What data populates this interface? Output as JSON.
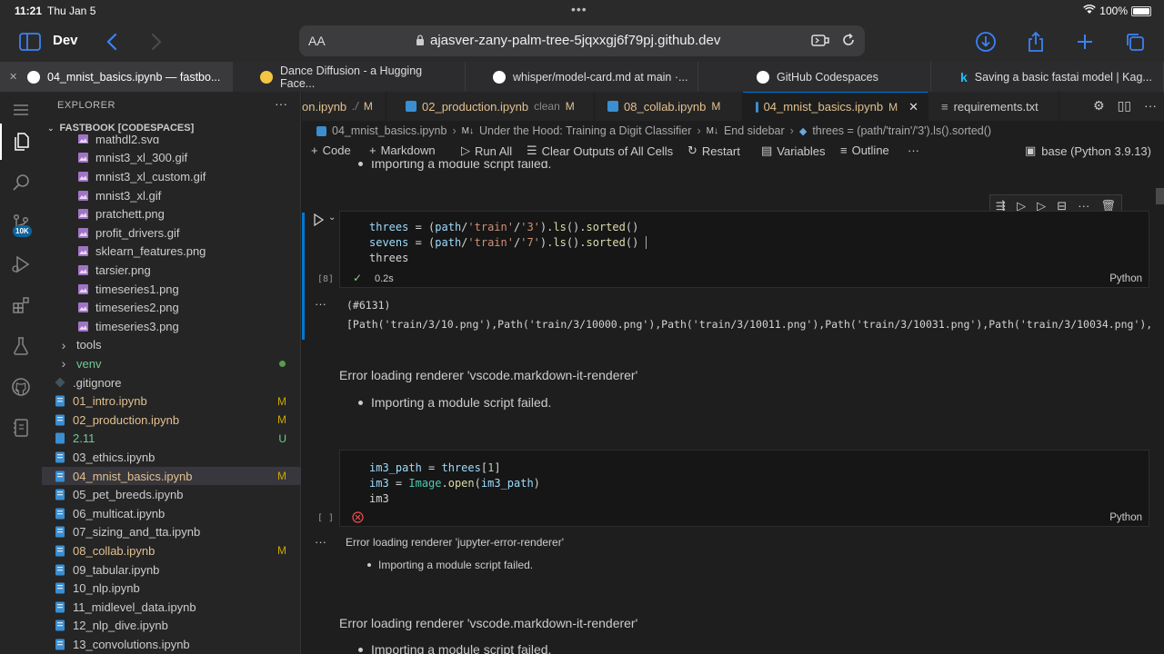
{
  "status": {
    "time": "11:21",
    "date": "Thu Jan 5",
    "battery": "100%"
  },
  "browser": {
    "sidebar_label": "Dev",
    "text_size": "AA",
    "url": "ajasver-zany-palm-tree-5jqxxgj6f79pj.github.dev",
    "tabs": [
      {
        "title": "04_mnist_basics.ipynb — fastbo...",
        "active": true
      },
      {
        "title": "Dance Diffusion - a Hugging Face..."
      },
      {
        "title": "whisper/model-card.md at main ·..."
      },
      {
        "title": "GitHub Codespaces"
      },
      {
        "title": "Saving a basic fastai model | Kag..."
      }
    ]
  },
  "explorer": {
    "title": "EXPLORER",
    "section": "FASTBOOK [CODESPACES]",
    "items": [
      {
        "name": "mathdl2.svg"
      },
      {
        "name": "mnist3_xl_300.gif"
      },
      {
        "name": "mnist3_xl_custom.gif"
      },
      {
        "name": "mnist3_xl.gif"
      },
      {
        "name": "pratchett.png"
      },
      {
        "name": "profit_drivers.gif"
      },
      {
        "name": "sklearn_features.png"
      },
      {
        "name": "tarsier.png"
      },
      {
        "name": "timeseries1.png"
      },
      {
        "name": "timeseries2.png"
      },
      {
        "name": "timeseries3.png"
      },
      {
        "name": "tools"
      },
      {
        "name": "venv"
      },
      {
        "name": ".gitignore"
      },
      {
        "name": "01_intro.ipynb",
        "status": "M"
      },
      {
        "name": "02_production.ipynb",
        "status": "M"
      },
      {
        "name": "2.11",
        "status": "U"
      },
      {
        "name": "03_ethics.ipynb"
      },
      {
        "name": "04_mnist_basics.ipynb",
        "status": "M"
      },
      {
        "name": "05_pet_breeds.ipynb"
      },
      {
        "name": "06_multicat.ipynb"
      },
      {
        "name": "07_sizing_and_tta.ipynb"
      },
      {
        "name": "08_collab.ipynb",
        "status": "M"
      },
      {
        "name": "09_tabular.ipynb"
      },
      {
        "name": "10_nlp.ipynb"
      },
      {
        "name": "11_midlevel_data.ipynb"
      },
      {
        "name": "12_nlp_dive.ipynb"
      },
      {
        "name": "13_convolutions.ipynb"
      }
    ]
  },
  "activity": {
    "badge": "10K"
  },
  "editor": {
    "tabs": [
      {
        "title": "on.ipynb",
        "extra": "./",
        "mark": "M"
      },
      {
        "title": "02_production.ipynb",
        "extra": "clean",
        "mark": "M"
      },
      {
        "title": "08_collab.ipynb",
        "mark": "M"
      },
      {
        "title": "04_mnist_basics.ipynb",
        "mark": "M",
        "active": true
      },
      {
        "title": "requirements.txt"
      }
    ],
    "breadcrumbs": [
      "04_mnist_basics.ipynb",
      "Under the Hood: Training a Digit Classifier",
      "End sidebar",
      "threes = (path/'train'/'3').ls().sorted()"
    ],
    "toolbar": {
      "code": "Code",
      "markdown": "Markdown",
      "run_all": "Run All",
      "clear": "Clear Outputs of All Cells",
      "restart": "Restart",
      "variables": "Variables",
      "outline": "Outline",
      "kernel": "base (Python 3.9.13)"
    }
  },
  "notebook": {
    "top_bullet": "Importing a module script failed.",
    "cell1": {
      "lines": [
        "threes = (path/'train'/'3').ls().sorted()",
        "sevens = (path/'train'/'7').ls().sorted()",
        "threes"
      ],
      "exec_count": "[8]",
      "duration": "0.2s",
      "lang": "Python"
    },
    "output1": {
      "line1": "(#6131)",
      "line2": "[Path('train/3/10.png'),Path('train/3/10000.png'),Path('train/3/10011.png'),Path('train/3/10031.png'),Path('train/3/10034.png'),Pat"
    },
    "error1": {
      "heading": "Error loading renderer 'vscode.markdown-it-renderer'",
      "bullet": "Importing a module script failed."
    },
    "cell2": {
      "lines": [
        "im3_path = threes[1]",
        "im3 = Image.open(im3_path)",
        "im3"
      ],
      "exec_count": "[ ]",
      "lang": "Python"
    },
    "error2": {
      "heading": "Error loading renderer 'jupyter-error-renderer'",
      "bullet": "Importing a module script failed."
    },
    "error3": {
      "heading": "Error loading renderer 'vscode.markdown-it-renderer'",
      "bullet": "Importing a module script failed."
    }
  }
}
